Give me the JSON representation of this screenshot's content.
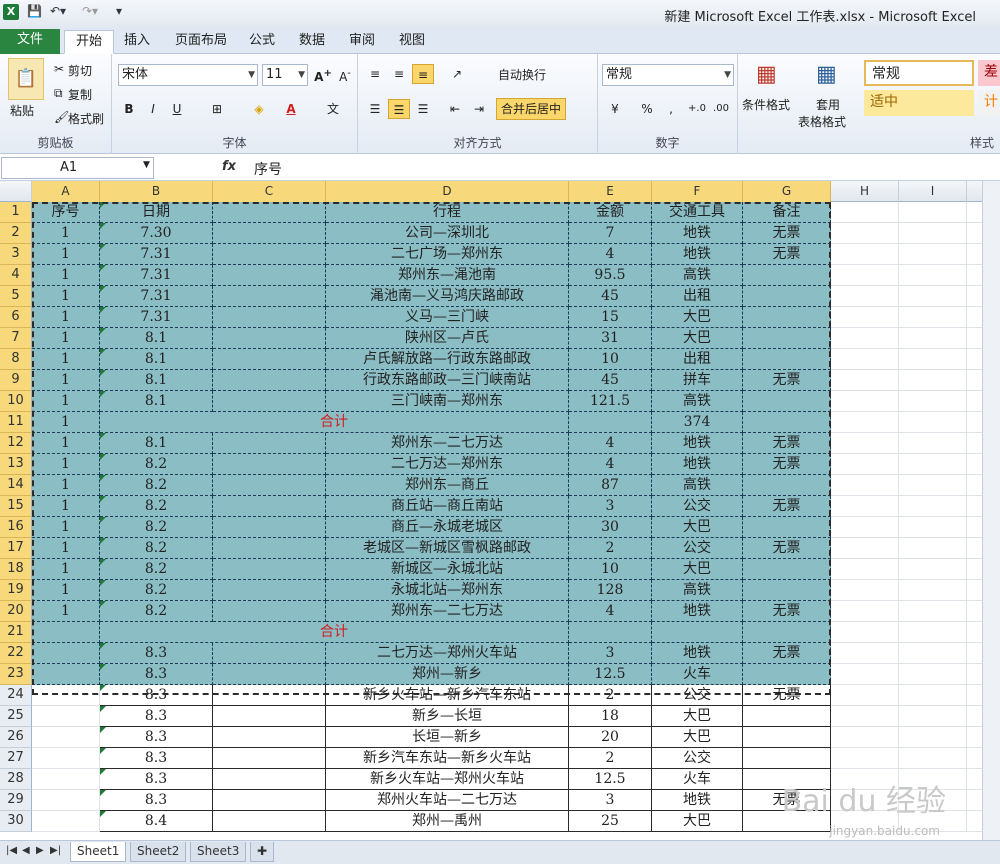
{
  "window": {
    "title": "新建 Microsoft Excel 工作表.xlsx - Microsoft Excel"
  },
  "tabs": [
    "文件",
    "开始",
    "插入",
    "页面布局",
    "公式",
    "数据",
    "审阅",
    "视图"
  ],
  "ribbon": {
    "clipboard": {
      "paste": "粘贴",
      "cut": "剪切",
      "copy": "复制",
      "format_painter": "格式刷",
      "label": "剪贴板"
    },
    "font": {
      "name": "宋体",
      "size": "11",
      "bold": "B",
      "italic": "I",
      "underline": "U",
      "label": "字体"
    },
    "align": {
      "wrap": "自动换行",
      "merge": "合并后居中",
      "label": "对齐方式"
    },
    "number": {
      "format": "常规",
      "percent": "%",
      "comma": ",",
      "label": "数字"
    },
    "styles": {
      "cond": "条件格式",
      "table_a": "套用",
      "table_b": "表格格式",
      "normal": "常规",
      "bad": "差",
      "neutral": "适中",
      "calc": "计",
      "label": "样式"
    }
  },
  "formula_bar": {
    "name_box": "A1",
    "fx": "fx",
    "content": "序号"
  },
  "columns": [
    "A",
    "B",
    "C",
    "D",
    "E",
    "F",
    "G",
    "H",
    "I"
  ],
  "rows": [
    {
      "n": "1",
      "a": "序号",
      "b": "日期",
      "c": "",
      "d": "行程",
      "e": "金额",
      "f": "交通工具",
      "g": "备注"
    },
    {
      "n": "2",
      "a": "1",
      "b": "7.30",
      "c": "",
      "d": "公司—深圳北",
      "e": "7",
      "f": "地铁",
      "g": "无票"
    },
    {
      "n": "3",
      "a": "1",
      "b": "7.31",
      "c": "",
      "d": "二七广场—郑州东",
      "e": "4",
      "f": "地铁",
      "g": "无票"
    },
    {
      "n": "4",
      "a": "1",
      "b": "7.31",
      "c": "",
      "d": "郑州东—渑池南",
      "e": "95.5",
      "f": "高铁",
      "g": ""
    },
    {
      "n": "5",
      "a": "1",
      "b": "7.31",
      "c": "",
      "d": "渑池南—义马鸿庆路邮政",
      "e": "45",
      "f": "出租",
      "g": ""
    },
    {
      "n": "6",
      "a": "1",
      "b": "7.31",
      "c": "",
      "d": "义马—三门峡",
      "e": "15",
      "f": "大巴",
      "g": ""
    },
    {
      "n": "7",
      "a": "1",
      "b": "8.1",
      "c": "",
      "d": "陕州区—卢氏",
      "e": "31",
      "f": "大巴",
      "g": ""
    },
    {
      "n": "8",
      "a": "1",
      "b": "8.1",
      "c": "",
      "d": "卢氏解放路—行政东路邮政",
      "e": "10",
      "f": "出租",
      "g": ""
    },
    {
      "n": "9",
      "a": "1",
      "b": "8.1",
      "c": "",
      "d": "行政东路邮政—三门峡南站",
      "e": "45",
      "f": "拼车",
      "g": "无票"
    },
    {
      "n": "10",
      "a": "1",
      "b": "8.1",
      "c": "",
      "d": "三门峡南—郑州东",
      "e": "121.5",
      "f": "高铁",
      "g": ""
    },
    {
      "n": "11",
      "a": "1",
      "b": "",
      "c": "",
      "d": "合计",
      "e": "",
      "f": "374",
      "g": "",
      "total": true
    },
    {
      "n": "12",
      "a": "1",
      "b": "8.1",
      "c": "",
      "d": "郑州东—二七万达",
      "e": "4",
      "f": "地铁",
      "g": "无票"
    },
    {
      "n": "13",
      "a": "1",
      "b": "8.2",
      "c": "",
      "d": "二七万达—郑州东",
      "e": "4",
      "f": "地铁",
      "g": "无票"
    },
    {
      "n": "14",
      "a": "1",
      "b": "8.2",
      "c": "",
      "d": "郑州东—商丘",
      "e": "87",
      "f": "高铁",
      "g": ""
    },
    {
      "n": "15",
      "a": "1",
      "b": "8.2",
      "c": "",
      "d": "商丘站—商丘南站",
      "e": "3",
      "f": "公交",
      "g": "无票"
    },
    {
      "n": "16",
      "a": "1",
      "b": "8.2",
      "c": "",
      "d": "商丘—永城老城区",
      "e": "30",
      "f": "大巴",
      "g": ""
    },
    {
      "n": "17",
      "a": "1",
      "b": "8.2",
      "c": "",
      "d": "老城区—新城区雪枫路邮政",
      "e": "2",
      "f": "公交",
      "g": "无票"
    },
    {
      "n": "18",
      "a": "1",
      "b": "8.2",
      "c": "",
      "d": "新城区—永城北站",
      "e": "10",
      "f": "大巴",
      "g": ""
    },
    {
      "n": "19",
      "a": "1",
      "b": "8.2",
      "c": "",
      "d": "永城北站—郑州东",
      "e": "128",
      "f": "高铁",
      "g": ""
    },
    {
      "n": "20",
      "a": "1",
      "b": "8.2",
      "c": "",
      "d": "郑州东—二七万达",
      "e": "4",
      "f": "地铁",
      "g": "无票"
    },
    {
      "n": "21",
      "a": "",
      "b": "",
      "c": "",
      "d": "合计",
      "e": "",
      "f": "",
      "g": "",
      "total": true
    },
    {
      "n": "22",
      "a": "",
      "b": "8.3",
      "c": "",
      "d": "二七万达—郑州火车站",
      "e": "3",
      "f": "地铁",
      "g": "无票"
    },
    {
      "n": "23",
      "a": "",
      "b": "8.3",
      "c": "",
      "d": "郑州—新乡",
      "e": "12.5",
      "f": "火车",
      "g": ""
    },
    {
      "n": "24",
      "a": "",
      "b": "8.3",
      "c": "",
      "d": "新乡火车站—新乡汽车东站",
      "e": "2",
      "f": "公交",
      "g": "无票"
    },
    {
      "n": "25",
      "a": "",
      "b": "8.3",
      "c": "",
      "d": "新乡—长垣",
      "e": "18",
      "f": "大巴",
      "g": ""
    },
    {
      "n": "26",
      "a": "",
      "b": "8.3",
      "c": "",
      "d": "长垣—新乡",
      "e": "20",
      "f": "大巴",
      "g": ""
    },
    {
      "n": "27",
      "a": "",
      "b": "8.3",
      "c": "",
      "d": "新乡汽车东站—新乡火车站",
      "e": "2",
      "f": "公交",
      "g": ""
    },
    {
      "n": "28",
      "a": "",
      "b": "8.3",
      "c": "",
      "d": "新乡火车站—郑州火车站",
      "e": "12.5",
      "f": "火车",
      "g": ""
    },
    {
      "n": "29",
      "a": "",
      "b": "8.3",
      "c": "",
      "d": "郑州火车站—二七万达",
      "e": "3",
      "f": "地铁",
      "g": "无票"
    },
    {
      "n": "30",
      "a": "",
      "b": "8.4",
      "c": "",
      "d": "郑州—禹州",
      "e": "25",
      "f": "大巴",
      "g": ""
    }
  ],
  "sheets": [
    "Sheet1",
    "Sheet2",
    "Sheet3"
  ],
  "watermark": {
    "text": "Bai du 经验",
    "url": "jingyan.baidu.com"
  },
  "colors": {
    "selection_fill": "#8bbdc4",
    "header_selected": "#f7d97b",
    "total_text": "#d11e1e",
    "file_tab": "#2a8540"
  }
}
